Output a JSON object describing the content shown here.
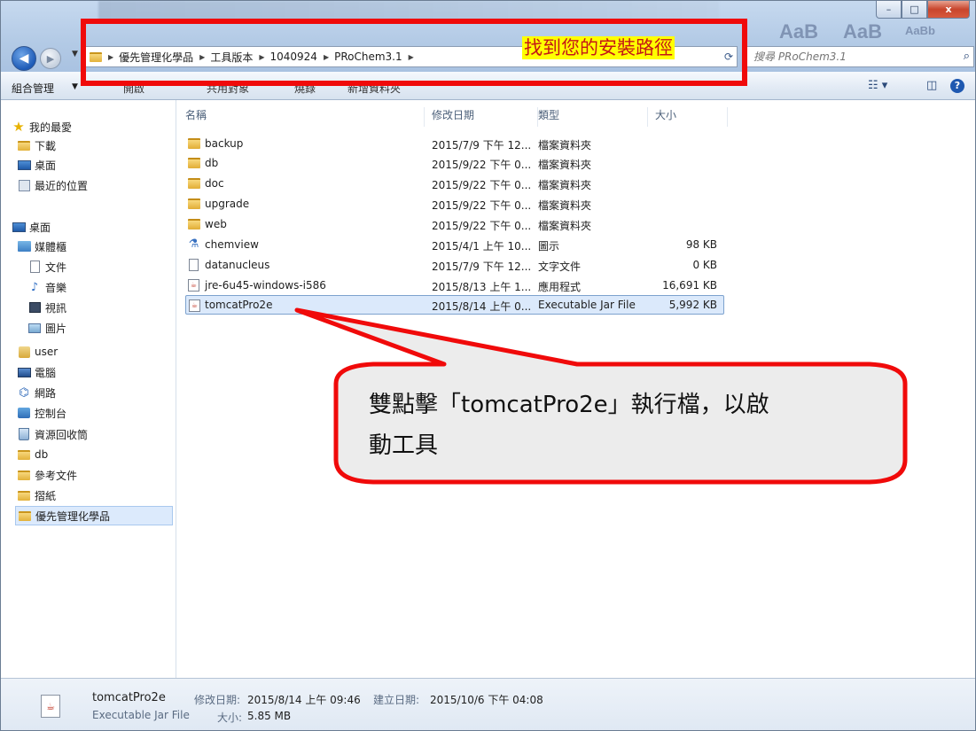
{
  "window": {
    "minimize_glyph": "–",
    "maximize_glyph": "□",
    "close_glyph": "x"
  },
  "ghost_titlebar": {
    "text_a": "AaB",
    "text_b": "AaB",
    "text_c": "AaBb"
  },
  "address": {
    "crumbs": [
      "優先管理化學品",
      "工具版本",
      "1040924",
      "PRoChem3.1"
    ],
    "annotation_label": "找到您的安裝路徑"
  },
  "search": {
    "placeholder": "搜尋 PRoChem3.1"
  },
  "toolbar": {
    "organize": "組合管理",
    "include": "開啟",
    "share": "共用對象",
    "burn": "燒錄",
    "new_folder": "新增資料夾"
  },
  "nav": {
    "favorites": "我的最愛",
    "downloads": "下載",
    "desktop_fav": "桌面",
    "recent": "最近的位置",
    "desktop": "桌面",
    "libraries": "媒體櫃",
    "documents": "文件",
    "music": "音樂",
    "videos": "視訊",
    "pictures": "圖片",
    "user": "user",
    "computer": "電腦",
    "network": "網路",
    "control_panel": "控制台",
    "recycle_bin": "資源回收筒",
    "db": "db",
    "ref_docs": "參考文件",
    "scrap": "摺紙",
    "priority": "優先管理化學品"
  },
  "columns": {
    "name": "名稱",
    "modified": "修改日期",
    "type": "類型",
    "size": "大小"
  },
  "files": [
    {
      "name": "backup",
      "modified": "2015/7/9 下午 12...",
      "type": "檔案資料夾",
      "size": "",
      "icon": "folder-icon"
    },
    {
      "name": "db",
      "modified": "2015/9/22 下午 0...",
      "type": "檔案資料夾",
      "size": "",
      "icon": "folder-icon"
    },
    {
      "name": "doc",
      "modified": "2015/9/22 下午 0...",
      "type": "檔案資料夾",
      "size": "",
      "icon": "folder-icon"
    },
    {
      "name": "upgrade",
      "modified": "2015/9/22 下午 0...",
      "type": "檔案資料夾",
      "size": "",
      "icon": "folder-icon"
    },
    {
      "name": "web",
      "modified": "2015/9/22 下午 0...",
      "type": "檔案資料夾",
      "size": "",
      "icon": "folder-icon"
    },
    {
      "name": "chemview",
      "modified": "2015/4/1 上午 10...",
      "type": "圖示",
      "size": "98 KB",
      "icon": "flask-icon"
    },
    {
      "name": "datanucleus",
      "modified": "2015/7/9 下午 12...",
      "type": "文字文件",
      "size": "0 KB",
      "icon": "text-file-icon"
    },
    {
      "name": "jre-6u45-windows-i586",
      "modified": "2015/8/13 上午 1...",
      "type": "應用程式",
      "size": "16,691 KB",
      "icon": "java-installer-icon"
    },
    {
      "name": "tomcatPro2e",
      "modified": "2015/8/14 上午 0...",
      "type": "Executable Jar File",
      "size": "5,992 KB",
      "icon": "jar-file-icon"
    }
  ],
  "callout": {
    "line1": "雙點擊「tomcatPro2e」執行檔，以啟",
    "line2": "動工具"
  },
  "details": {
    "name": "tomcatPro2e",
    "type": "Executable Jar File",
    "modified_label": "修改日期:",
    "modified_value": "2015/8/14 上午 09:46",
    "created_label": "建立日期:",
    "created_value": "2015/10/6 下午 04:08",
    "size_label": "大小:",
    "size_value": "5.85 MB"
  },
  "colors": {
    "annotation_red": "#f00a0a",
    "highlight_yellow": "#ffff00",
    "selection_blue": "#dbe9fb"
  }
}
